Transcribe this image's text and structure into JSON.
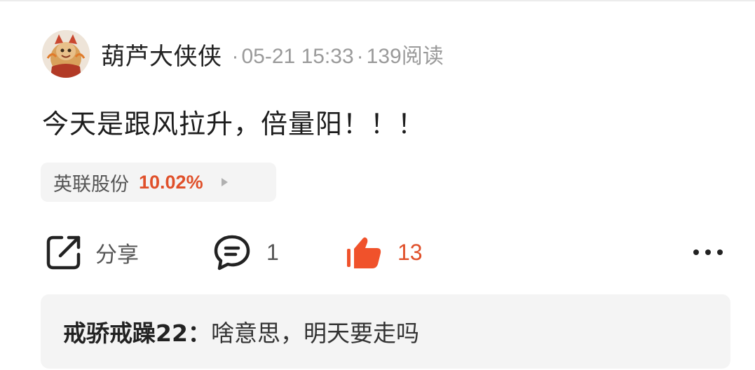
{
  "post": {
    "author": "葫芦大侠侠",
    "date": "05-21 15:33",
    "reads": "139阅读",
    "separator": "·",
    "text": "今天是跟风拉升，倍量阳！！！"
  },
  "stock_tag": {
    "name": "英联股份",
    "change": "10.02%",
    "change_color": "#e0502a"
  },
  "actions": {
    "share_label": "分享",
    "comment_count": "1",
    "like_count": "13",
    "like_color": "#f0522b"
  },
  "comment_preview": {
    "author": "戒骄戒躁22：",
    "text": "啥意思，明天要走吗"
  },
  "icons": {
    "avatar": "avatar",
    "share": "share-icon",
    "comment": "comment-icon",
    "like": "thumbs-up-icon",
    "more": "more-dots-icon",
    "arrow": "chevron-right-icon"
  }
}
